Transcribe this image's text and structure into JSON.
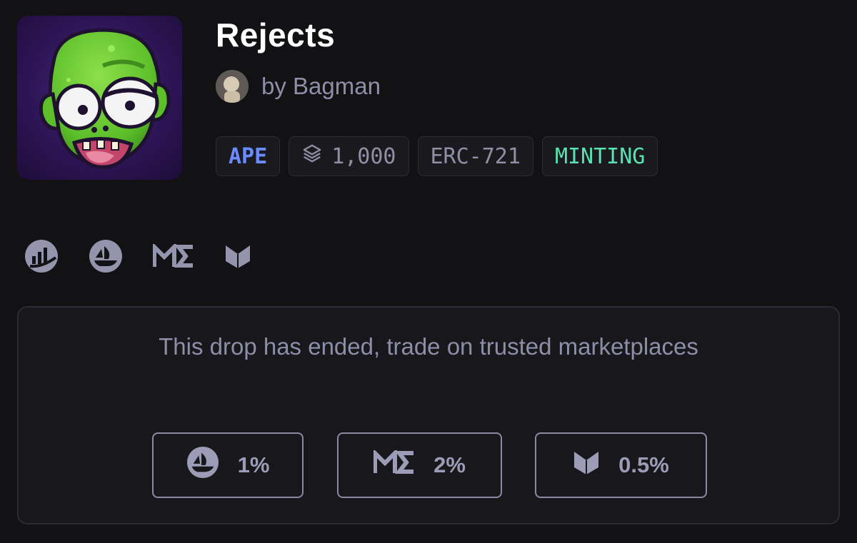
{
  "collection": {
    "title": "Rejects",
    "creator": "by Bagman",
    "cover_icon": "zombie-artwork",
    "avatar_icon": "creator-avatar"
  },
  "tags": {
    "chain": "APE",
    "supply": "1,000",
    "supply_icon": "layers-icon",
    "standard": "ERC-721",
    "status": "MINTING"
  },
  "marketplace_links": [
    {
      "name": "analytics-icon"
    },
    {
      "name": "opensea-icon"
    },
    {
      "name": "magic-eden-icon"
    },
    {
      "name": "blur-icon"
    }
  ],
  "panel": {
    "message": "This drop has ended, trade on trusted marketplaces",
    "fees": {
      "opensea": "1%",
      "magic_eden": "2%",
      "blur": "0.5%"
    }
  },
  "colors": {
    "background": "#121214",
    "chain_accent": "#6b8cff",
    "status_accent": "#58e3b0",
    "muted_text": "#8e8ea8"
  }
}
